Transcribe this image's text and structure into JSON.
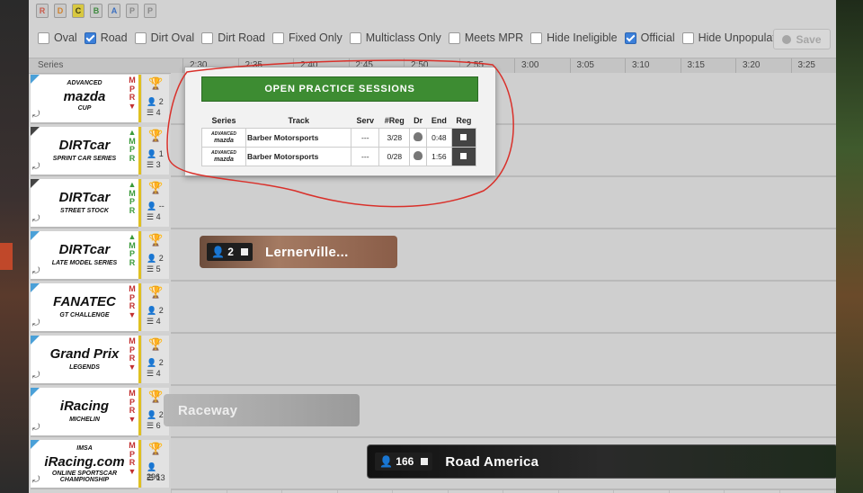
{
  "license_filters": [
    "R",
    "D",
    "C",
    "B",
    "A",
    "P",
    "P"
  ],
  "filters": [
    {
      "label": "Oval",
      "checked": false
    },
    {
      "label": "Road",
      "checked": true
    },
    {
      "label": "Dirt Oval",
      "checked": false
    },
    {
      "label": "Dirt Road",
      "checked": false
    },
    {
      "label": "Fixed Only",
      "checked": false
    },
    {
      "label": "Multiclass Only",
      "checked": false
    },
    {
      "label": "Meets MPR",
      "checked": false
    },
    {
      "label": "Hide Ineligible",
      "checked": false
    },
    {
      "label": "Official",
      "checked": true
    },
    {
      "label": "Hide Unpopulated",
      "checked": false
    }
  ],
  "save_label": "Save",
  "header": {
    "series_label": "Series",
    "times": [
      "2:30",
      "2:35",
      "2:40",
      "2:45",
      "2:50",
      "2:55",
      "3:00",
      "3:05",
      "3:10",
      "3:15",
      "3:20",
      "3:25"
    ]
  },
  "rows": [
    {
      "logo_lines": [
        "ADVANCED",
        "mazda",
        "CUP"
      ],
      "mpr": "MPR",
      "mpr_color": "red",
      "mpr_arrow": "▼",
      "users": "2",
      "sessions": "4"
    },
    {
      "logo_lines": [
        "DIRTcar",
        "SPRINT CAR SERIES"
      ],
      "mpr": "MPR",
      "mpr_color": "green",
      "mpr_arrow": "▲",
      "users": "1",
      "sessions": "3"
    },
    {
      "logo_lines": [
        "DIRTcar",
        "STREET STOCK"
      ],
      "mpr": "MPR",
      "mpr_color": "green",
      "mpr_arrow": "▲",
      "users": "--",
      "sessions": "4"
    },
    {
      "logo_lines": [
        "DIRTcar",
        "LATE MODEL SERIES"
      ],
      "mpr": "MPR",
      "mpr_color": "green",
      "mpr_arrow": "▲",
      "users": "2",
      "sessions": "5"
    },
    {
      "logo_lines": [
        "FANATEC",
        "GT CHALLENGE"
      ],
      "mpr": "MPR",
      "mpr_color": "red",
      "mpr_arrow": "▼",
      "users": "2",
      "sessions": "4"
    },
    {
      "logo_lines": [
        "Grand Prix",
        "LEGENDS"
      ],
      "mpr": "MPR",
      "mpr_color": "red",
      "mpr_arrow": "▼",
      "users": "2",
      "sessions": "4"
    },
    {
      "logo_lines": [
        "iRacing",
        "MICHELIN"
      ],
      "mpr": "MPR",
      "mpr_color": "red",
      "mpr_arrow": "▼",
      "users": "22",
      "sessions": "6"
    },
    {
      "logo_lines": [
        "IMSA",
        "iRacing.com",
        "ONLINE SPORTSCAR CHAMPIONSHIP"
      ],
      "mpr": "MPR",
      "mpr_color": "red",
      "mpr_arrow": "▼",
      "users": "296",
      "sessions": "13"
    }
  ],
  "sessions": [
    {
      "count": "2",
      "track": "Lernerville..."
    },
    {
      "count": "",
      "track": "Raceway"
    },
    {
      "count": "166",
      "track": "Road America"
    }
  ],
  "popup": {
    "title": "OPEN PRACTICE SESSIONS",
    "columns": [
      "Series",
      "Track",
      "Serv",
      "#Reg",
      "Dr",
      "End",
      "Reg"
    ],
    "rows": [
      {
        "series": [
          "ADVANCED",
          "mazda",
          "CUP"
        ],
        "track": "Barber Motorsports",
        "serv": "---",
        "reg": "3/28",
        "end": "0:48"
      },
      {
        "series": [
          "ADVANCED",
          "mazda",
          "CUP"
        ],
        "track": "Barber Motorsports",
        "serv": "---",
        "reg": "0/28",
        "end": "1:56"
      }
    ]
  },
  "colors": {
    "accent_green": "#3d8c32",
    "checkbox_blue": "#3b7fd9",
    "annotation_red": "#d9302a"
  }
}
